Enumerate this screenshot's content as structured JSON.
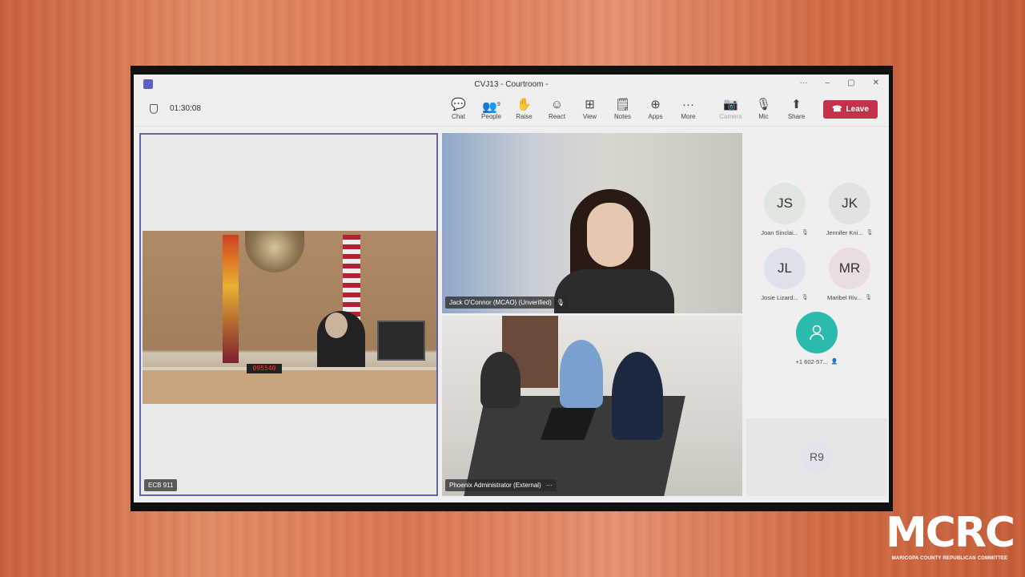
{
  "window": {
    "title": "CVJ13 - Courtroom -",
    "controls": [
      "···",
      "–",
      "▢",
      "✕"
    ]
  },
  "toolbar": {
    "timer": "01:30:08",
    "items": [
      {
        "label": "Chat",
        "icon": "chat-icon",
        "glyph": "💬",
        "enabled": true
      },
      {
        "label": "People",
        "icon": "people-icon",
        "glyph": "👥",
        "enabled": true,
        "badge": "9"
      },
      {
        "label": "Raise",
        "icon": "raise-hand-icon",
        "glyph": "✋",
        "enabled": true
      },
      {
        "label": "React",
        "icon": "react-icon",
        "glyph": "☺",
        "enabled": true
      },
      {
        "label": "View",
        "icon": "view-icon",
        "glyph": "⊞",
        "enabled": true
      },
      {
        "label": "Notes",
        "icon": "notes-icon",
        "glyph": "🗒",
        "enabled": true
      },
      {
        "label": "Apps",
        "icon": "apps-icon",
        "glyph": "⊕",
        "enabled": true
      },
      {
        "label": "More",
        "icon": "more-icon",
        "glyph": "···",
        "enabled": true
      },
      {
        "label": "Camera",
        "icon": "camera-icon",
        "glyph": "📷",
        "enabled": false
      },
      {
        "label": "Mic",
        "icon": "mic-off-icon",
        "glyph": "🎙",
        "enabled": true
      },
      {
        "label": "Share",
        "icon": "share-icon",
        "glyph": "⬆",
        "enabled": true
      }
    ],
    "leave_label": "Leave",
    "leave_color": "#c4314b"
  },
  "tiles": {
    "courtroom": {
      "name": "ECB 911",
      "clock": "095540"
    },
    "jack": {
      "name": "Jack O'Connor (MCAO) (Unverified)"
    },
    "phoenix": {
      "name": "Phoenix Administrator (External)",
      "more": "···"
    }
  },
  "roster": [
    {
      "initials": "JS",
      "name": "Joan Sinclai...",
      "color": "#dfe6df"
    },
    {
      "initials": "JK",
      "name": "Jennifer Kni...",
      "color": "#e2e2e2"
    },
    {
      "initials": "JL",
      "name": "Josie Lizard...",
      "color": "#dde2ec"
    },
    {
      "initials": "MR",
      "name": "Maribel Riv...",
      "color": "#eadcdf"
    },
    {
      "initials": "",
      "name": "+1 602-57...",
      "color": "#2bbbad"
    }
  ],
  "overflow_tile": {
    "initials": "R9"
  },
  "brand": {
    "logo_text": "MCRC",
    "subtitle": "MARICOPA COUNTY REPUBLICAN COMMITTEE"
  }
}
